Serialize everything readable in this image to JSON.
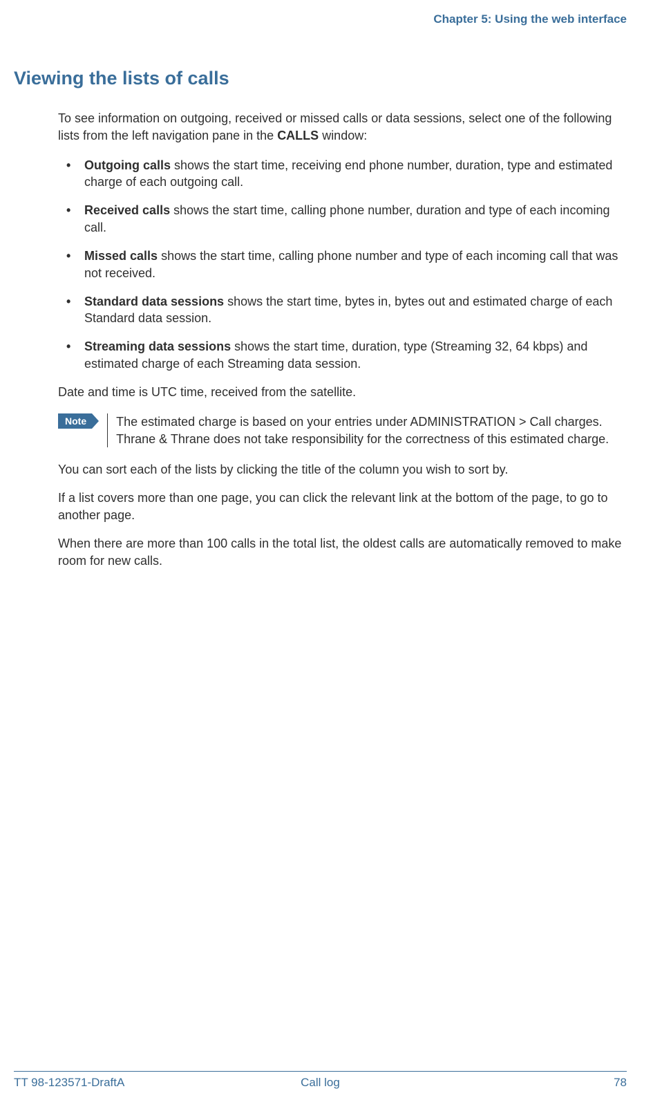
{
  "header": {
    "chapter": "Chapter 5: Using the web interface"
  },
  "title": "Viewing the lists of calls",
  "intro": {
    "pre": "To see information on outgoing, received or missed calls or data sessions, select one of the following lists from the left navigation pane in the ",
    "bold": "CALLS",
    "post": " window:"
  },
  "bullets": [
    {
      "term": "Outgoing calls",
      "rest": " shows the start time, receiving end phone number, duration, type and estimated charge of each outgoing call."
    },
    {
      "term": "Received calls",
      "rest": " shows the start time, calling phone number, duration and type of each incoming call."
    },
    {
      "term": "Missed calls",
      "rest": " shows the start time, calling phone number and type of each incoming call that was not received."
    },
    {
      "term": "Standard data sessions",
      "rest": " shows the start time, bytes in, bytes out and estimated charge of each Standard data session."
    },
    {
      "term": "Streaming data sessions",
      "rest": " shows the start time, duration, type (Streaming 32, 64 kbps) and estimated charge of each Streaming data session."
    }
  ],
  "utc_line": "Date and time is UTC time, received from the satellite.",
  "note": {
    "label": "Note",
    "text": "The estimated charge is based on your entries under ADMINISTRATION > Call charges. Thrane & Thrane does not take responsibility for the correctness of this estimated charge."
  },
  "sort_line": "You can sort each of the lists by clicking the title of the column you wish to sort by.",
  "pagination_line": "If a list covers more than one page, you can click the relevant link at the bottom of the page, to go to another page.",
  "overflow_line": "When there are more than 100 calls in the total list, the oldest calls are automatically removed to make room for new calls.",
  "footer": {
    "doc_id": "TT 98-123571-DraftA",
    "section": "Call log",
    "page": "78"
  }
}
